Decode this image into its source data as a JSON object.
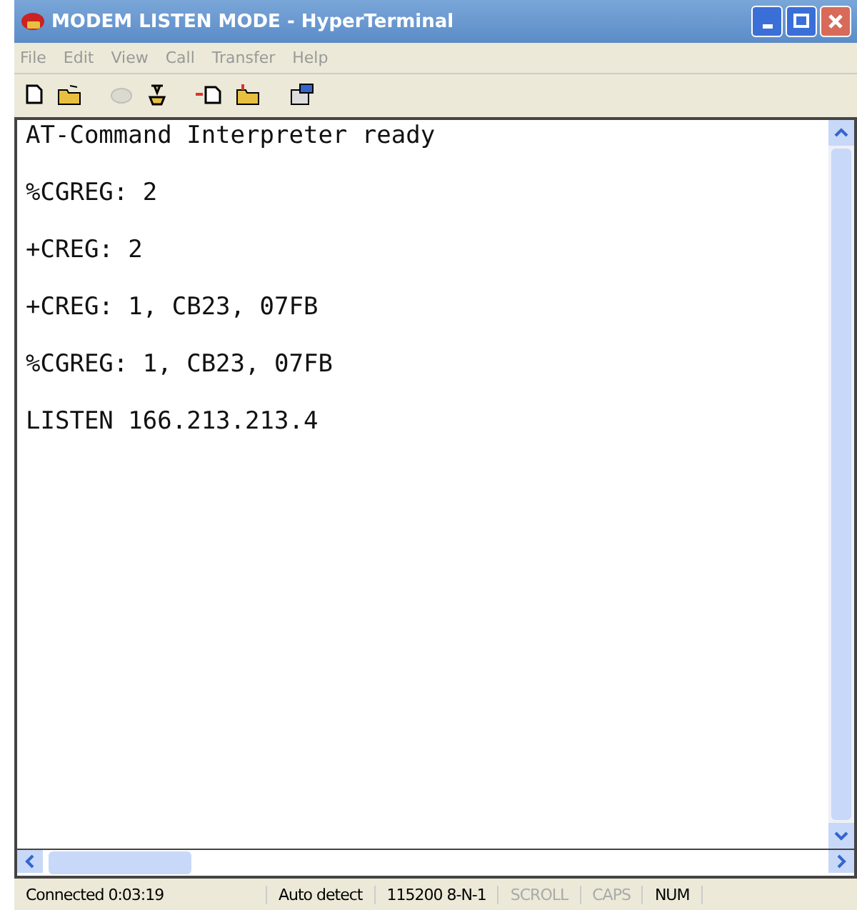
{
  "window": {
    "title": "MODEM LISTEN MODE - HyperTerminal"
  },
  "menu": [
    "File",
    "Edit",
    "View",
    "Call",
    "Transfer",
    "Help"
  ],
  "toolbar": [
    {
      "kind": "new",
      "disabled": false
    },
    {
      "kind": "open",
      "disabled": false
    },
    {
      "kind": "disconnect",
      "disabled": true
    },
    {
      "kind": "dial",
      "disabled": false
    },
    {
      "kind": "send",
      "disabled": false
    },
    {
      "kind": "receive",
      "disabled": false
    },
    {
      "kind": "properties",
      "disabled": false
    }
  ],
  "terminal": {
    "lines": [
      "AT-Command Interpreter ready",
      "%CGREG: 2",
      "+CREG: 2",
      "+CREG: 1, CB23, 07FB",
      "%CGREG: 1, CB23, 07FB",
      "LISTEN 166.213.213.4"
    ]
  },
  "status_bar": [
    {
      "text": "Connected 0:03:19",
      "active": true
    },
    {
      "text": "Auto detect",
      "active": true
    },
    {
      "text": "115200 8-N-1",
      "active": true
    },
    {
      "text": "SCROLL",
      "active": false
    },
    {
      "text": "CAPS",
      "active": false
    },
    {
      "text": "NUM",
      "active": true
    }
  ]
}
